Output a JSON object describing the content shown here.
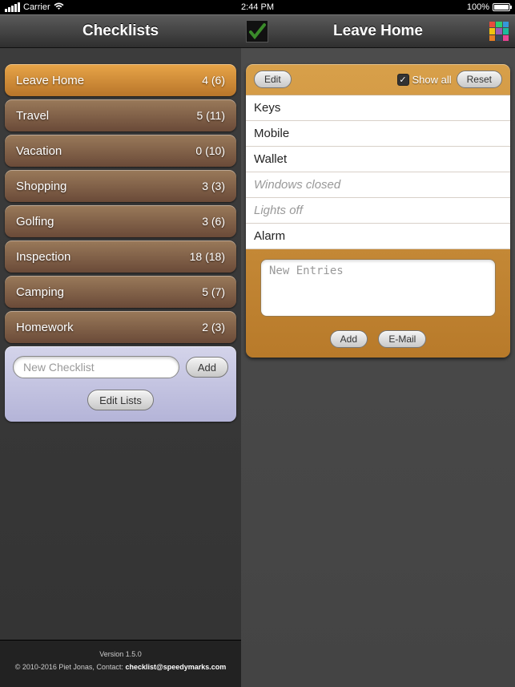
{
  "statusbar": {
    "carrier": "Carrier",
    "time": "2:44 PM",
    "battery_pct": "100%"
  },
  "left": {
    "title": "Checklists",
    "items": [
      {
        "label": "Leave Home",
        "count": "4 (6)",
        "selected": true
      },
      {
        "label": "Travel",
        "count": "5 (11)",
        "selected": false
      },
      {
        "label": "Vacation",
        "count": "0 (10)",
        "selected": false
      },
      {
        "label": "Shopping",
        "count": "3 (3)",
        "selected": false
      },
      {
        "label": "Golfing",
        "count": "3 (6)",
        "selected": false
      },
      {
        "label": "Inspection",
        "count": "18 (18)",
        "selected": false
      },
      {
        "label": "Camping",
        "count": "5 (7)",
        "selected": false
      },
      {
        "label": "Homework",
        "count": "2 (3)",
        "selected": false
      }
    ],
    "new_placeholder": "New Checklist",
    "add_label": "Add",
    "edit_lists_label": "Edit Lists"
  },
  "footer": {
    "version": "Version 1.5.0",
    "copyright": "© 2010-2016 Piet Jonas, Contact: ",
    "email": "checklist@speedymarks.com"
  },
  "right": {
    "title": "Leave Home",
    "edit_label": "Edit",
    "showall_label": "Show all",
    "showall_checked": true,
    "reset_label": "Reset",
    "items": [
      {
        "label": "Keys",
        "done": false
      },
      {
        "label": "Mobile",
        "done": false
      },
      {
        "label": "Wallet",
        "done": false
      },
      {
        "label": "Windows closed",
        "done": true
      },
      {
        "label": "Lights off",
        "done": true
      },
      {
        "label": "Alarm",
        "done": false
      }
    ],
    "new_entries_placeholder": "New Entries",
    "add_label": "Add",
    "email_label": "E-Mail"
  },
  "palette_colors": [
    "#e74c3c",
    "#2ecc71",
    "#3498db",
    "#f1c40f",
    "#9b59b6",
    "#1abc9c",
    "#e67e22",
    "#34495e",
    "#e84393"
  ]
}
